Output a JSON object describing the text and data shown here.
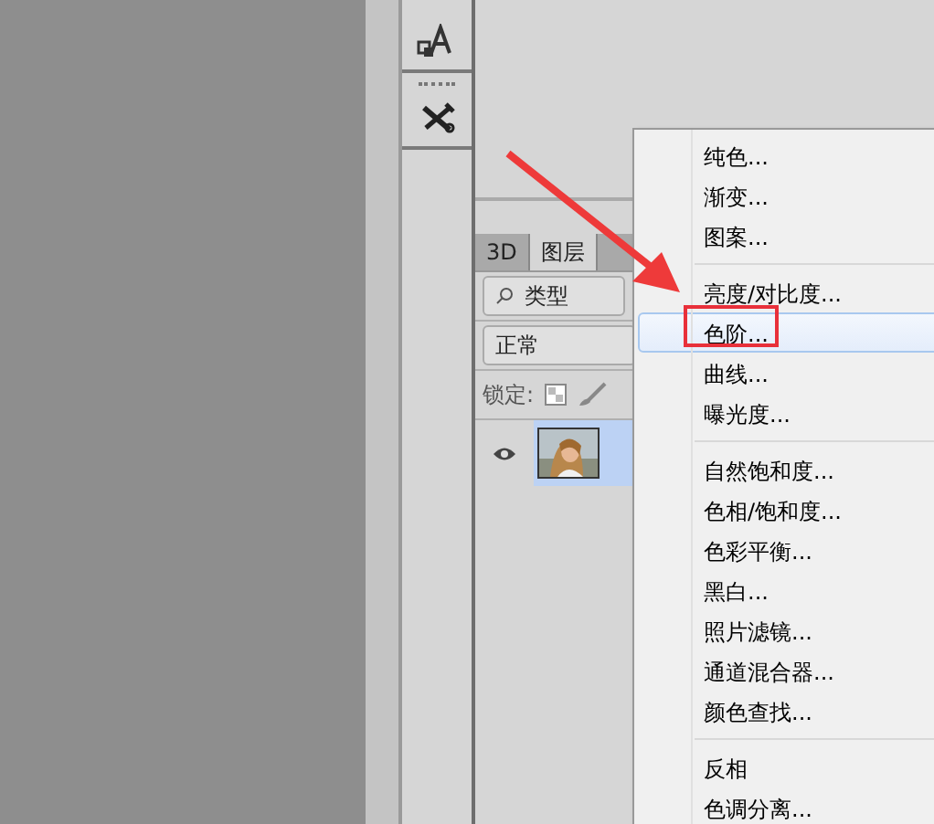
{
  "toolbar": {
    "tools": [
      {
        "kind": "type-mask"
      },
      {
        "kind": "tools"
      }
    ]
  },
  "layers_panel": {
    "tabs": [
      {
        "label": "3D",
        "selected": false
      },
      {
        "label": "图层",
        "selected": true
      },
      {
        "selected": false
      }
    ],
    "filter": {
      "value": "类型"
    },
    "blend_mode": {
      "value": "正常"
    },
    "lock_label": "锁定:",
    "layers": [
      {
        "visible": true,
        "selected": true
      }
    ]
  },
  "context_menu": {
    "items": [
      {
        "kind": "item",
        "label": "纯色...",
        "selected": false
      },
      {
        "kind": "item",
        "label": "渐变...",
        "selected": false
      },
      {
        "kind": "item",
        "label": "图案...",
        "selected": false
      },
      {
        "kind": "separator"
      },
      {
        "kind": "item",
        "label": "亮度/对比度...",
        "selected": false
      },
      {
        "kind": "item",
        "label": "色阶...",
        "selected": true
      },
      {
        "kind": "item",
        "label": "曲线...",
        "selected": false
      },
      {
        "kind": "item",
        "label": "曝光度...",
        "selected": false
      },
      {
        "kind": "separator"
      },
      {
        "kind": "item",
        "label": "自然饱和度...",
        "selected": false
      },
      {
        "kind": "item",
        "label": "色相/饱和度...",
        "selected": false
      },
      {
        "kind": "item",
        "label": "色彩平衡...",
        "selected": false
      },
      {
        "kind": "item",
        "label": "黑白...",
        "selected": false
      },
      {
        "kind": "item",
        "label": "照片滤镜...",
        "selected": false
      },
      {
        "kind": "item",
        "label": "通道混合器...",
        "selected": false
      },
      {
        "kind": "item",
        "label": "颜色查找...",
        "selected": false
      },
      {
        "kind": "separator"
      },
      {
        "kind": "item",
        "label": "反相",
        "selected": false
      },
      {
        "kind": "item",
        "label": "色调分离...",
        "selected": false
      }
    ]
  }
}
